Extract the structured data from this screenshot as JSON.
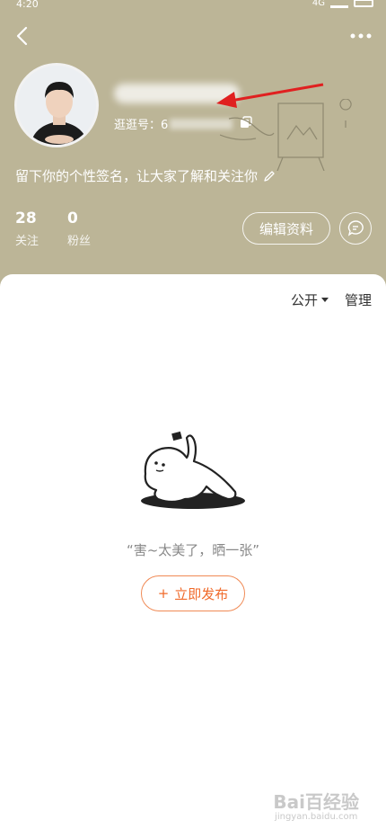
{
  "status_bar": {
    "time": "4:20",
    "network": "4G"
  },
  "profile": {
    "uid_label": "逛逛号：6",
    "signature": "留下你的个性签名，让大家了解和关注你",
    "stats": [
      {
        "value": "28",
        "label": "关注"
      },
      {
        "value": "0",
        "label": "粉丝"
      }
    ],
    "edit_label": "编辑资料"
  },
  "content": {
    "visibility": "公开",
    "manage_label": "管理",
    "empty_text": "“害~太美了，晒一张”",
    "publish_plus": "+",
    "publish_label": "立即发布"
  },
  "colors": {
    "header_bg": "#bcb597",
    "accent": "#f06a2a",
    "annotation_arrow": "#e02020"
  },
  "icons": [
    "back-icon",
    "more-icon",
    "copy-icon",
    "pencil-icon",
    "message-icon",
    "dropdown-icon"
  ],
  "watermark": {
    "text": "Bai百经验",
    "sub": "jingyan.baidu.com"
  }
}
